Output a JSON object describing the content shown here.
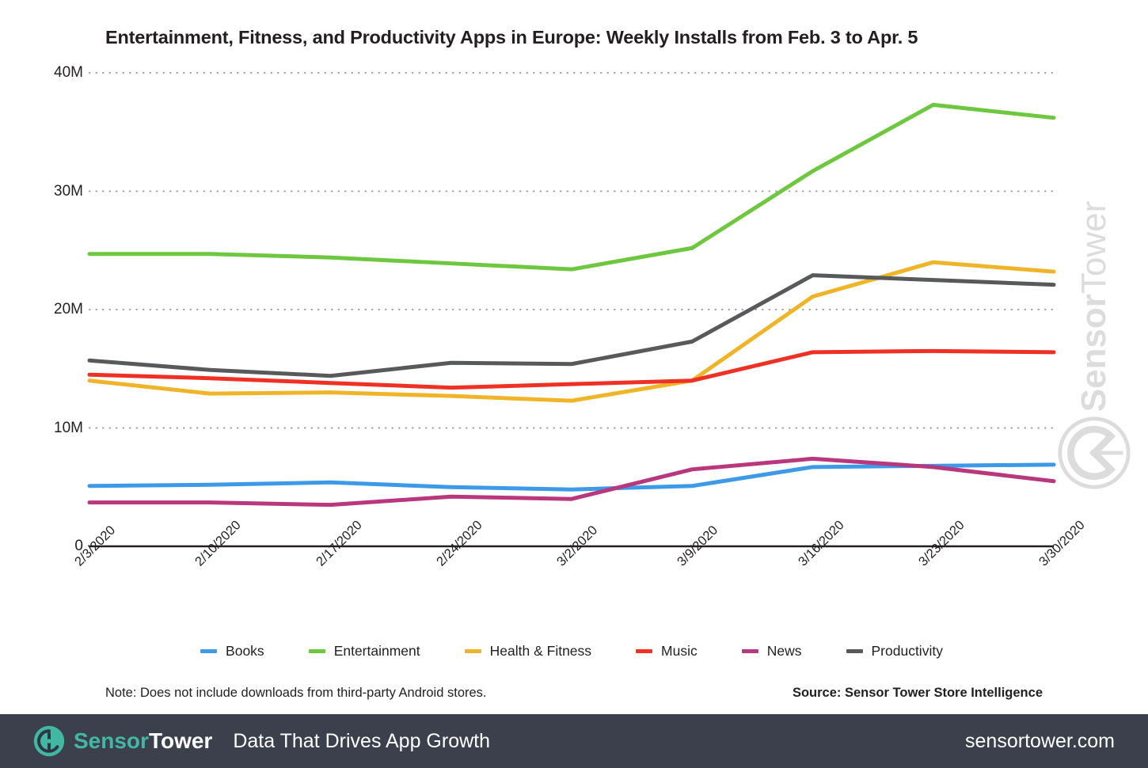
{
  "chart_data": {
    "type": "line",
    "title": "Entertainment, Fitness, and Productivity Apps in Europe: Weekly Installs from Feb. 3 to Apr. 5",
    "xlabel": "",
    "ylabel": "",
    "ylim": [
      0,
      40000000
    ],
    "yticks": [
      0,
      10000000,
      20000000,
      30000000,
      40000000
    ],
    "ytick_labels": [
      "0",
      "10M",
      "20M",
      "30M",
      "40M"
    ],
    "grid": true,
    "legend_position": "bottom",
    "categories": [
      "2/3/2020",
      "2/10/2020",
      "2/17/2020",
      "2/24/2020",
      "3/2/2020",
      "3/9/2020",
      "3/16/2020",
      "3/23/2020",
      "3/30/2020"
    ],
    "series": [
      {
        "name": "Books",
        "color": "#3d9ae8",
        "values": [
          5100000,
          5200000,
          5400000,
          5000000,
          4800000,
          5100000,
          6700000,
          6800000,
          6900000
        ]
      },
      {
        "name": "Entertainment",
        "color": "#6dc73f",
        "values": [
          24700000,
          24700000,
          24400000,
          23900000,
          23400000,
          25200000,
          31700000,
          37300000,
          36200000
        ]
      },
      {
        "name": "Health & Fitness",
        "color": "#f0b429",
        "values": [
          14000000,
          12900000,
          13000000,
          12700000,
          12300000,
          14000000,
          21100000,
          24000000,
          23200000
        ]
      },
      {
        "name": "Music",
        "color": "#ee3124",
        "values": [
          14500000,
          14200000,
          13800000,
          13400000,
          13700000,
          14000000,
          16400000,
          16500000,
          16400000
        ]
      },
      {
        "name": "News",
        "color": "#b8377d",
        "values": [
          3700000,
          3700000,
          3500000,
          4200000,
          4000000,
          6500000,
          7400000,
          6700000,
          5500000
        ]
      },
      {
        "name": "Productivity",
        "color": "#58595b",
        "values": [
          15700000,
          14900000,
          14400000,
          15500000,
          15400000,
          17300000,
          22900000,
          22500000,
          22100000
        ]
      }
    ]
  },
  "legend": {
    "items": [
      {
        "label": "Books",
        "color": "#3d9ae8"
      },
      {
        "label": "Entertainment",
        "color": "#6dc73f"
      },
      {
        "label": "Health & Fitness",
        "color": "#f0b429"
      },
      {
        "label": "Music",
        "color": "#ee3124"
      },
      {
        "label": "News",
        "color": "#b8377d"
      },
      {
        "label": "Productivity",
        "color": "#58595b"
      }
    ]
  },
  "footnotes": {
    "note": "Note: Does not include downloads from third-party Android stores.",
    "source": "Source: Sensor Tower Store Intelligence"
  },
  "watermark": {
    "brand_first": "Sensor",
    "brand_second": "Tower"
  },
  "footer": {
    "brand_first": "Sensor",
    "brand_second": "Tower",
    "tagline": "Data That Drives App Growth",
    "url": "sensortower.com",
    "bar_color": "#3b404c",
    "accent_color": "#42b8a4"
  }
}
